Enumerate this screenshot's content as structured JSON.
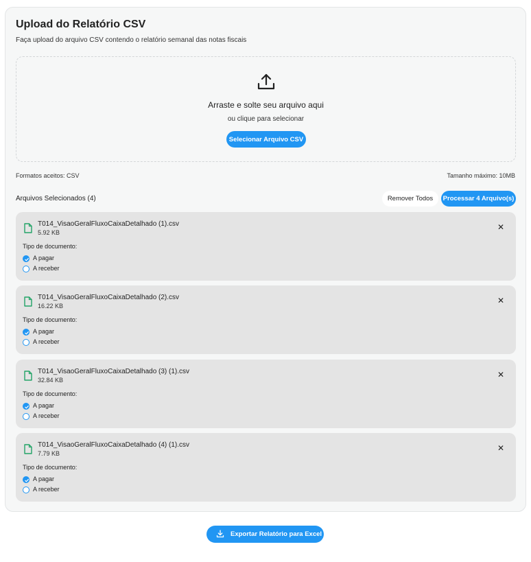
{
  "panel": {
    "title": "Upload do Relatório CSV",
    "subtitle": "Faça upload do arquivo CSV contendo o relatório semanal das notas fiscais"
  },
  "dropzone": {
    "icon": "upload-icon",
    "title": "Arraste e solte seu arquivo aqui",
    "subtitle": "ou clique para selecionar",
    "button_label": "Selecionar Arquivo CSV"
  },
  "info": {
    "formats": "Formatos aceitos: CSV",
    "max_size": "Tamanho máximo: 10MB"
  },
  "files": {
    "heading": "Arquivos Selecionados (4)",
    "remove_all_label": "Remover Todos",
    "process_label": "Processar 4 Arquivo(s)",
    "doc_type_label": "Tipo de documento:",
    "options": [
      "A pagar",
      "A receber"
    ],
    "items": [
      {
        "name": "T014_VisaoGeralFluxoCaixaDetalhado (1).csv",
        "size": "5.92 KB",
        "selected": "A pagar"
      },
      {
        "name": "T014_VisaoGeralFluxoCaixaDetalhado (2).csv",
        "size": "16.22 KB",
        "selected": "A pagar"
      },
      {
        "name": "T014_VisaoGeralFluxoCaixaDetalhado (3) (1).csv",
        "size": "32.84 KB",
        "selected": "A pagar"
      },
      {
        "name": "T014_VisaoGeralFluxoCaixaDetalhado (4) (1).csv",
        "size": "7.79 KB",
        "selected": "A pagar"
      }
    ]
  },
  "export": {
    "label": "Exportar Relatório para Excel",
    "icon": "download-icon"
  },
  "colors": {
    "accent": "#2196f3",
    "file_icon": "#21a366",
    "card_bg": "#e4e4e4",
    "panel_bg": "#f6f7f7"
  }
}
